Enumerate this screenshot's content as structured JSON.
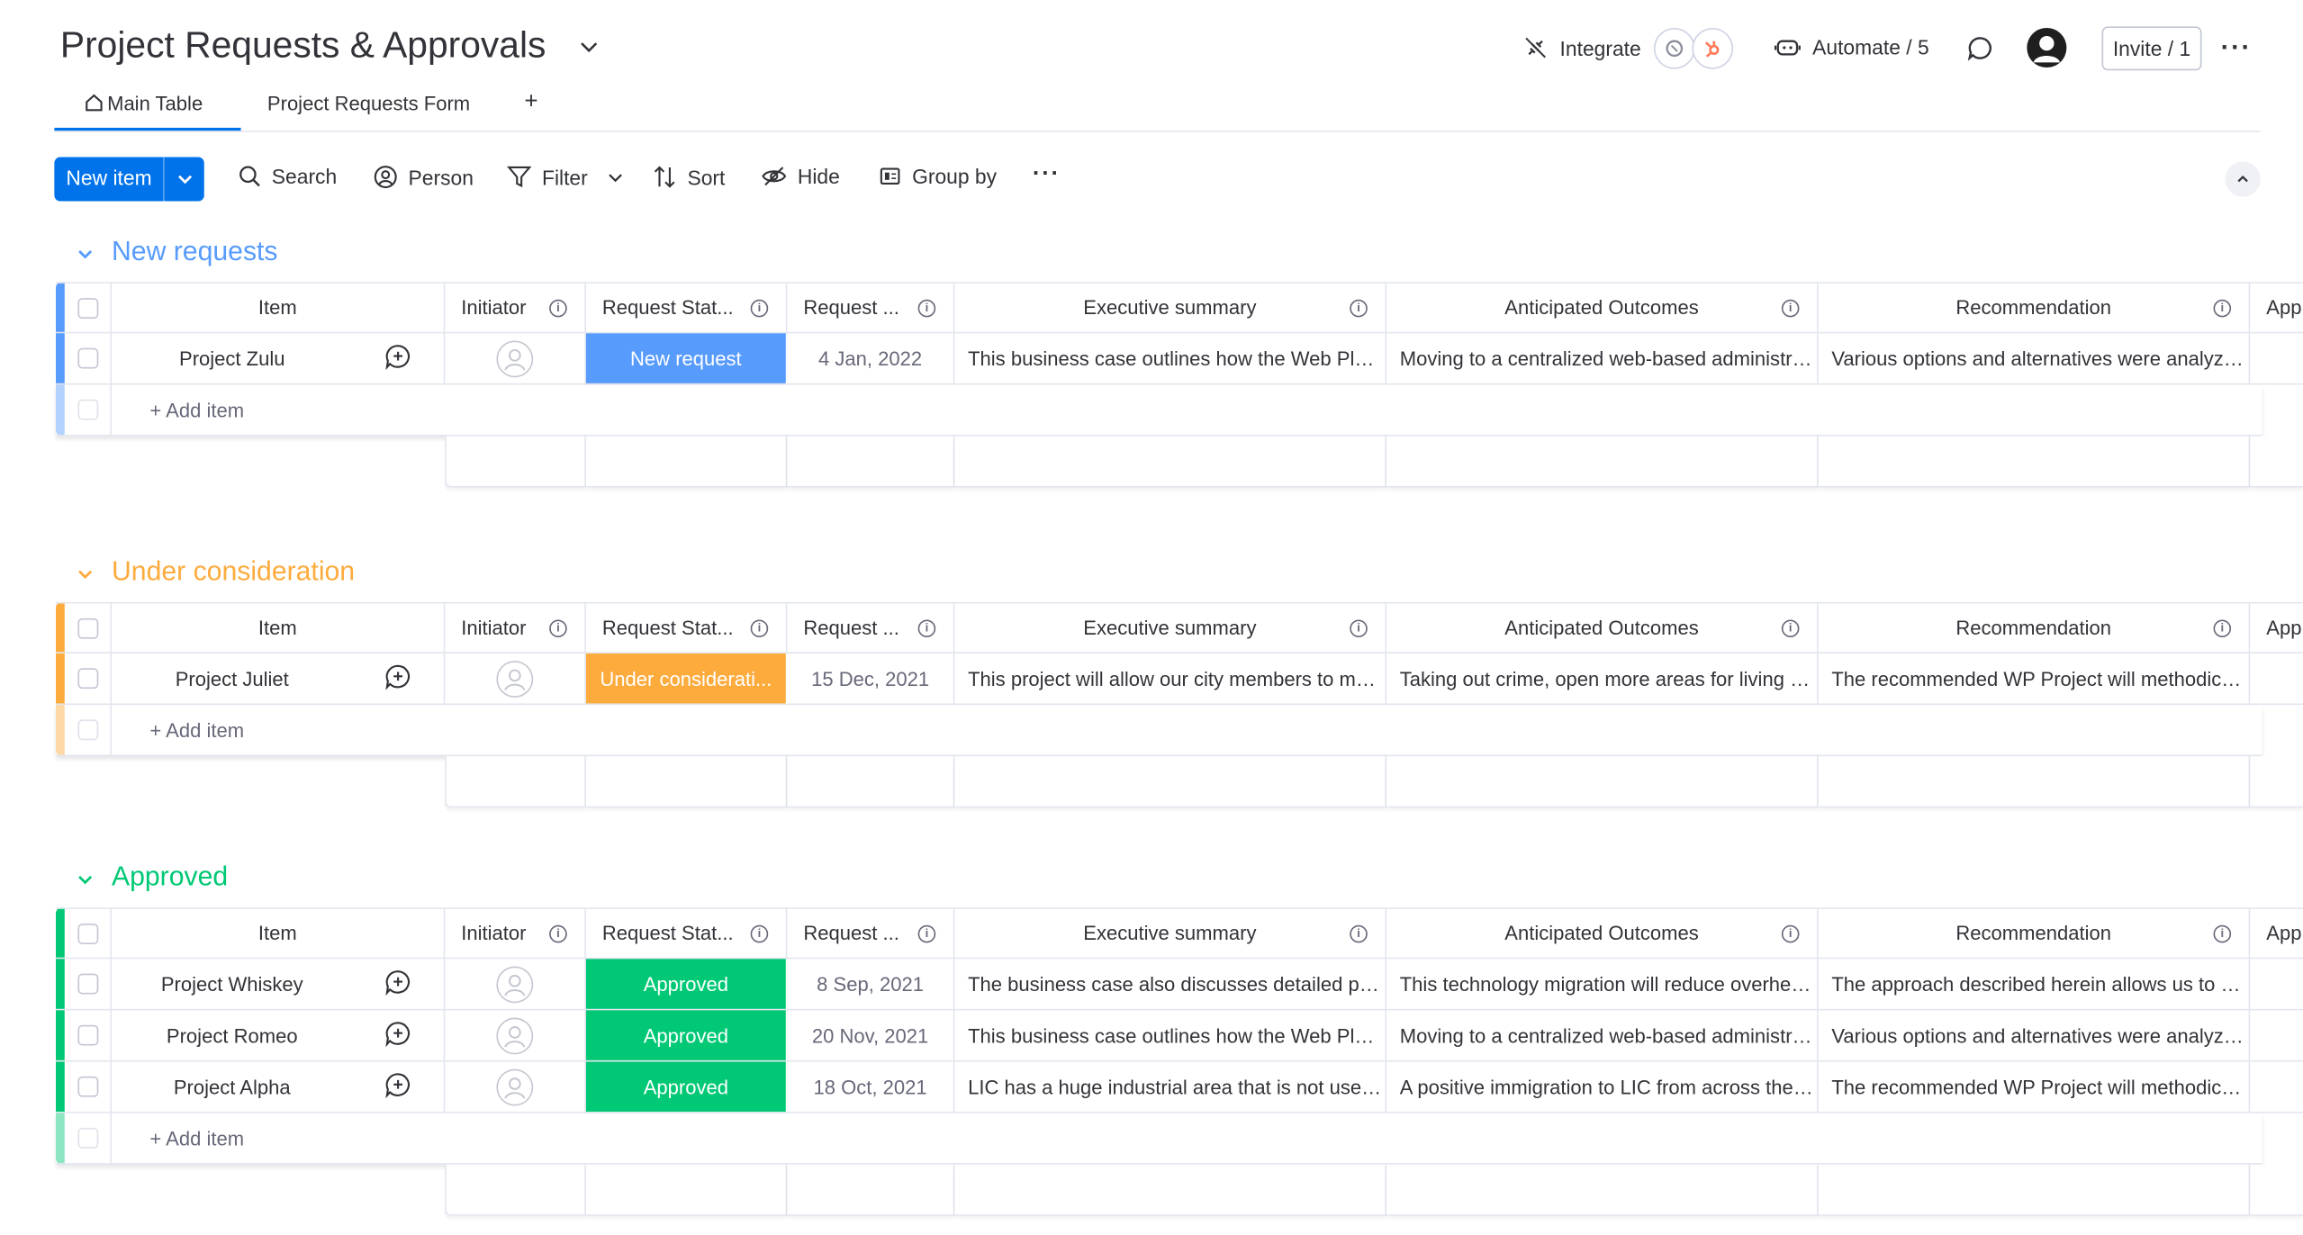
{
  "header": {
    "title": "Project Requests & Approvals",
    "integrate_label": "Integrate",
    "automate_label": "Automate / 5",
    "invite_label": "Invite / 1"
  },
  "tabs": [
    {
      "label": "Main Table",
      "icon": "home-icon",
      "active": true
    },
    {
      "label": "Project Requests Form",
      "active": false
    },
    {
      "label": "+",
      "icon": "add-view-icon"
    }
  ],
  "toolbar": {
    "new_item_label": "New item",
    "search_label": "Search",
    "person_label": "Person",
    "filter_label": "Filter",
    "sort_label": "Sort",
    "hide_label": "Hide",
    "group_by_label": "Group by"
  },
  "columns": {
    "item": "Item",
    "initiator": "Initiator",
    "request_status": "Request Stat...",
    "request_date": "Request ...",
    "executive_summary": "Executive summary",
    "anticipated_outcomes": "Anticipated Outcomes",
    "recommendation": "Recommendation",
    "next": "App"
  },
  "add_item_label": "+ Add item",
  "colors": {
    "accent": "#0073ea",
    "new_requests": "#579bfc",
    "under_consideration": "#fdab3d",
    "approved": "#00c875"
  },
  "groups": [
    {
      "title": "New requests",
      "color": "#579bfc",
      "rows": [
        {
          "item": "Project Zulu",
          "status": "New request",
          "status_color": "#579bfc",
          "date": "4 Jan, 2022",
          "summary": "This business case outlines how the Web Platfo...",
          "outcomes": "Moving to a centralized web-based administrati...",
          "recommendation": "Various options and alternatives were analyzed ..."
        }
      ]
    },
    {
      "title": "Under consideration",
      "color": "#fdab3d",
      "rows": [
        {
          "item": "Project Juliet",
          "status": "Under considerati...",
          "status_color": "#fdab3d",
          "date": "15 Dec, 2021",
          "summary": "This project will allow our city members to mov...",
          "outcomes": "Taking out crime, open more areas for living and...",
          "recommendation": "The recommended WP Project will methodicall..."
        }
      ]
    },
    {
      "title": "Approved",
      "color": "#00c875",
      "rows": [
        {
          "item": "Project Whiskey",
          "status": "Approved",
          "status_color": "#00c875",
          "date": "8 Sep, 2021",
          "summary": "The business case also discusses detailed proje...",
          "outcomes": "This technology migration will reduce overhead...",
          "recommendation": "The approach described herein allows us to me..."
        },
        {
          "item": "Project Romeo",
          "status": "Approved",
          "status_color": "#00c875",
          "date": "20 Nov, 2021",
          "summary": "This business case outlines how the Web Platfo...",
          "outcomes": "Moving to a centralized web-based administrati...",
          "recommendation": "Various options and alternatives were analyzed ..."
        },
        {
          "item": "Project Alpha",
          "status": "Approved",
          "status_color": "#00c875",
          "date": "18 Oct, 2021",
          "summary": "LIC has a huge industrial area that is not used t...",
          "outcomes": "A positive immigration to LIC from across the ci...",
          "recommendation": "The recommended WP Project will methodicall..."
        }
      ]
    }
  ]
}
